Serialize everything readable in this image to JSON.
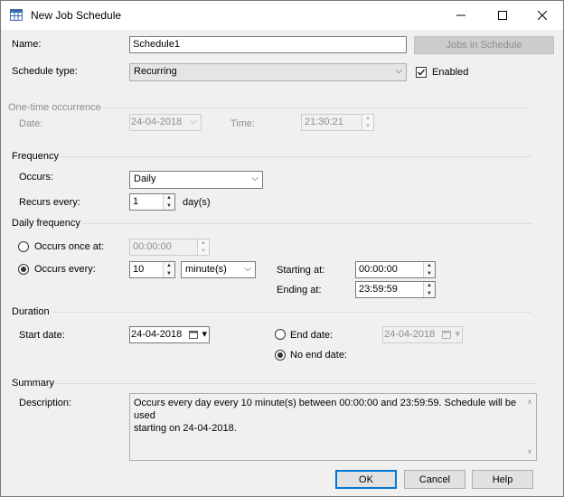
{
  "window": {
    "title": "New Job Schedule",
    "minimize": "—",
    "maximize": "☐",
    "close": "✕"
  },
  "form": {
    "name_label": "Name:",
    "name_value": "Schedule1",
    "jobs_button": "Jobs in Schedule",
    "schedule_type_label": "Schedule type:",
    "schedule_type_value": "Recurring",
    "enabled_label": "Enabled",
    "enabled_checked": true
  },
  "one_time": {
    "title": "One-time occurrence",
    "date_label": "Date:",
    "date_value": "24-04-2018",
    "time_label": "Time:",
    "time_value": "21:30:21"
  },
  "frequency": {
    "title": "Frequency",
    "occurs_label": "Occurs:",
    "occurs_value": "Daily",
    "recurs_label": "Recurs every:",
    "recurs_value": "1",
    "recurs_unit": "day(s)"
  },
  "daily": {
    "title": "Daily frequency",
    "once_label": "Occurs once at:",
    "once_value": "00:00:00",
    "every_label": "Occurs every:",
    "every_value": "10",
    "every_unit": "minute(s)",
    "starting_label": "Starting at:",
    "starting_value": "00:00:00",
    "ending_label": "Ending at:",
    "ending_value": "23:59:59",
    "selected": "every"
  },
  "duration": {
    "title": "Duration",
    "start_label": "Start date:",
    "start_value": "24-04-2018",
    "end_label": "End date:",
    "end_value": "24-04-2018",
    "no_end_label": "No end date:",
    "selected": "no_end"
  },
  "summary": {
    "title": "Summary",
    "desc_label": "Description:",
    "desc_line1": "Occurs every day every 10 minute(s) between 00:00:00 and 23:59:59. Schedule will be used",
    "desc_line2": "starting on 24-04-2018."
  },
  "buttons": {
    "ok": "OK",
    "cancel": "Cancel",
    "help": "Help"
  },
  "icons": {
    "chevron": "⌵",
    "spin_up": "▲",
    "spin_down": "▼",
    "scroll_up": "∧",
    "scroll_down": "∨",
    "check": "✓",
    "calendar_dropdown": "▾"
  },
  "colors": {
    "accent": "#0078d7",
    "disabled_text": "#8d8d8d"
  }
}
